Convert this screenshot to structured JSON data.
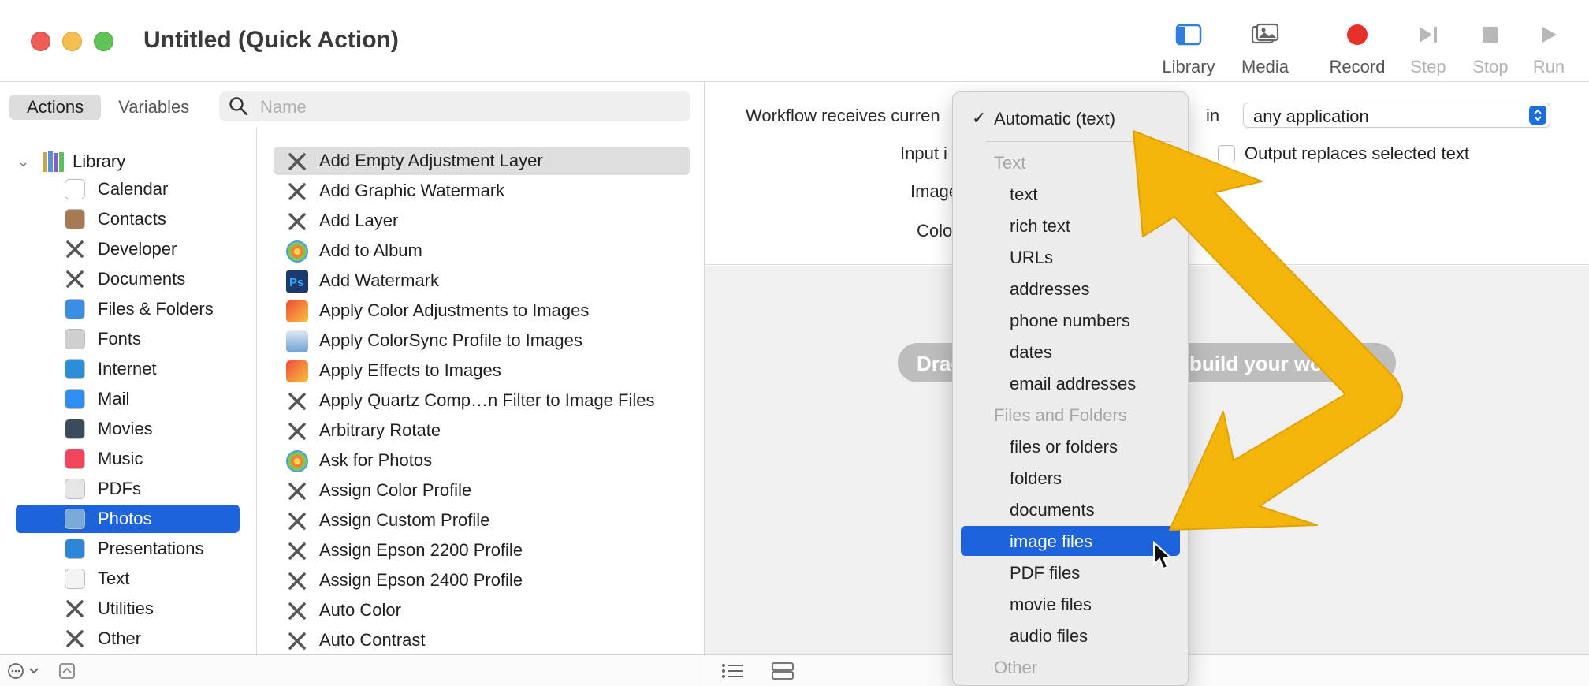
{
  "window": {
    "title": "Untitled (Quick Action)"
  },
  "toolbar": {
    "library": "Library",
    "media": "Media",
    "record": "Record",
    "step": "Step",
    "stop": "Stop",
    "run": "Run"
  },
  "left_panel": {
    "tabs": [
      "Actions",
      "Variables"
    ],
    "search_placeholder": "Name",
    "library_label": "Library",
    "categories": [
      {
        "label": "Calendar",
        "icon": "calendar-icon",
        "color": "#ffffff"
      },
      {
        "label": "Contacts",
        "icon": "contacts-icon",
        "color": "#a77b52"
      },
      {
        "label": "Developer",
        "icon": "tools-icon",
        "color": "#6b6b6b"
      },
      {
        "label": "Documents",
        "icon": "tools-icon",
        "color": "#6b6b6b"
      },
      {
        "label": "Files & Folders",
        "icon": "finder-icon",
        "color": "#3a8ee6"
      },
      {
        "label": "Fonts",
        "icon": "fonts-icon",
        "color": "#cfcfcf"
      },
      {
        "label": "Internet",
        "icon": "globe-icon",
        "color": "#2a8fd8"
      },
      {
        "label": "Mail",
        "icon": "mail-icon",
        "color": "#2f8df5"
      },
      {
        "label": "Movies",
        "icon": "quicktime-icon",
        "color": "#3b4a5c"
      },
      {
        "label": "Music",
        "icon": "music-icon",
        "color": "#f2445a"
      },
      {
        "label": "PDFs",
        "icon": "pdf-icon",
        "color": "#e6e6e6"
      },
      {
        "label": "Photos",
        "icon": "preview-icon",
        "color": "#7aa8d8"
      },
      {
        "label": "Presentations",
        "icon": "keynote-icon",
        "color": "#2d86d9"
      },
      {
        "label": "Text",
        "icon": "textedit-icon",
        "color": "#f4f4f4"
      },
      {
        "label": "Utilities",
        "icon": "tools-icon",
        "color": "#6b6b6b"
      },
      {
        "label": "Other",
        "icon": "tools-icon",
        "color": "#6b6b6b"
      }
    ],
    "selected_category": "Photos",
    "actions": [
      {
        "label": "Add Empty Adjustment Layer",
        "icon": "tools-icon"
      },
      {
        "label": "Add Graphic Watermark",
        "icon": "tools-icon"
      },
      {
        "label": "Add Layer",
        "icon": "tools-icon"
      },
      {
        "label": "Add to Album",
        "icon": "photos-icon"
      },
      {
        "label": "Add Watermark",
        "icon": "photoshop-icon"
      },
      {
        "label": "Apply Color Adjustments to Images",
        "icon": "colorsync-icon"
      },
      {
        "label": "Apply ColorSync Profile to Images",
        "icon": "preview-icon"
      },
      {
        "label": "Apply Effects to Images",
        "icon": "colorsync-icon"
      },
      {
        "label": "Apply Quartz Comp…n Filter to Image Files",
        "icon": "tools-icon"
      },
      {
        "label": "Arbitrary Rotate",
        "icon": "tools-icon"
      },
      {
        "label": "Ask for Photos",
        "icon": "photos-icon"
      },
      {
        "label": "Assign Color Profile",
        "icon": "tools-icon"
      },
      {
        "label": "Assign Custom Profile",
        "icon": "tools-icon"
      },
      {
        "label": "Assign Epson 2200 Profile",
        "icon": "tools-icon"
      },
      {
        "label": "Assign Epson 2400 Profile",
        "icon": "tools-icon"
      },
      {
        "label": "Auto Color",
        "icon": "tools-icon"
      },
      {
        "label": "Auto Contrast",
        "icon": "tools-icon"
      }
    ]
  },
  "workflow": {
    "receives_label": "Workflow receives curren",
    "in_label": "in",
    "app_value": "any application",
    "input_label": "Input i",
    "image_label": "Image",
    "color_label": "Colo",
    "output_checkbox_label": "Output replaces selected text",
    "drag_hint_left": "Drag",
    "drag_hint_right": "build your wo"
  },
  "menu": {
    "checked": "Automatic (text)",
    "sections": [
      {
        "header": "Text",
        "items": [
          "text",
          "rich text",
          "URLs",
          "addresses",
          "phone numbers",
          "dates",
          "email addresses"
        ]
      },
      {
        "header": "Files and Folders",
        "items": [
          "files or folders",
          "folders",
          "documents",
          "image files",
          "PDF files",
          "movie files",
          "audio files"
        ]
      },
      {
        "header": "Other",
        "items": []
      }
    ],
    "highlighted": "image files"
  },
  "colors": {
    "selection": "#1d64dc",
    "arrow": "#f5b40a",
    "record": "#e8302a"
  }
}
